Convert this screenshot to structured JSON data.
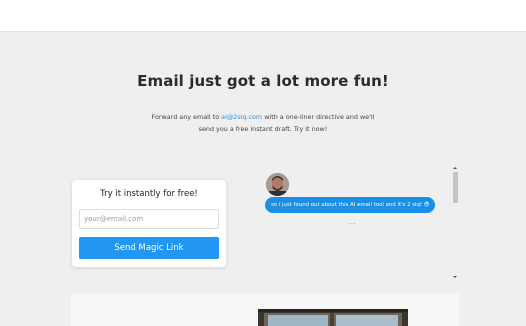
{
  "hero": {
    "headline": "Email just got a lot more fun!",
    "subtext_line1_prefix": "Forward any email to ",
    "email_address": "ai@2siq.com",
    "subtext_line1_suffix": " with a one-liner directive and we'll",
    "subtext_line2": "send you a free instant draft. Try it now!"
  },
  "signup_card": {
    "title": "Try it instantly for free!",
    "email_placeholder": "your@email.com",
    "email_value": "",
    "button_label": "Send Magic Link"
  },
  "chat": {
    "message": "so i just found out about this AI email tool and it's 2 siq! 😎",
    "typing_indicator": "...",
    "accent_color": "#1a8fe3"
  },
  "icons": {
    "avatar": "avatar-image",
    "scroll_up": "scroll-up-arrow-icon",
    "scroll_down": "scroll-down-arrow-icon"
  },
  "colors": {
    "background": "#efefef",
    "button": "#2196f3",
    "link": "#2f8fe0"
  }
}
